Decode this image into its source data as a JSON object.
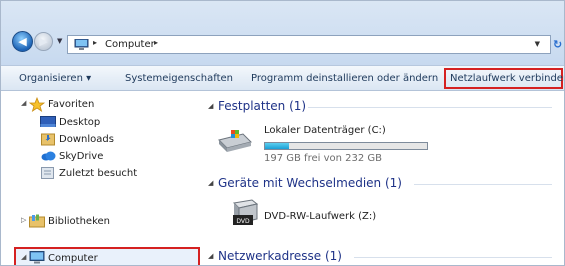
{
  "address_bar": {
    "breadcrumb": "Computer",
    "separator": "▸"
  },
  "toolbar": {
    "organize": "Organisieren ▾",
    "system_properties": "Systemeigenschaften",
    "uninstall": "Programm deinstallieren oder ändern",
    "map_drive": "Netzlaufwerk verbinden"
  },
  "nav_pane": {
    "favorites": "Favoriten",
    "desktop": "Desktop",
    "downloads": "Downloads",
    "skydrive": "SkyDrive",
    "recent": "Zuletzt besucht",
    "libraries": "Bibliotheken",
    "computer": "Computer"
  },
  "content": {
    "groups": [
      {
        "title": "Festplatten (1)"
      },
      {
        "title": "Geräte mit Wechselmedien (1)"
      },
      {
        "title": "Netzwerkadresse (1)"
      }
    ],
    "drives": [
      {
        "name": "Lokaler Datenträger (C:)",
        "space": "197 GB frei von 232 GB",
        "used_fraction": 0.15
      },
      {
        "name": "DVD-RW-Laufwerk (Z:)"
      }
    ]
  },
  "icons": [
    "back-arrow-icon",
    "forward-arrow-icon",
    "computer-icon",
    "star-icon",
    "desktop-icon",
    "downloads-folder-icon",
    "skydrive-cloud-icon",
    "recent-places-icon",
    "libraries-icon",
    "hard-drive-icon",
    "dvd-drive-icon",
    "refresh-icon"
  ],
  "colors": {
    "group_title": "#1e3287",
    "highlight_border": "#d52121",
    "space_bar_fill": "#1a9fd6"
  }
}
